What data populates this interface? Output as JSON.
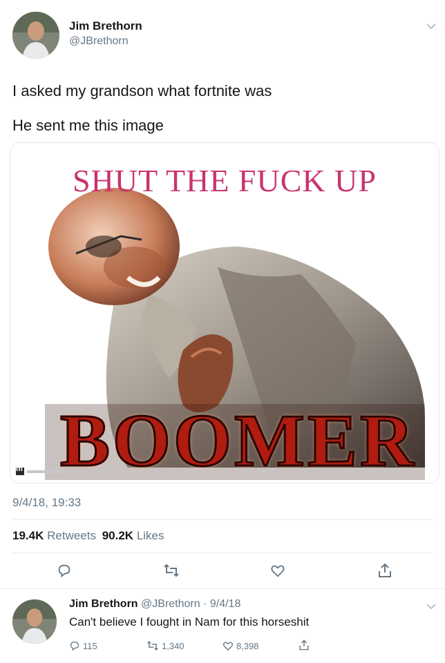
{
  "tweet": {
    "author_name": "Jim Brethorn",
    "author_handle": "@JBrethorn",
    "text_lines": [
      "I asked my grandson what fortnite was",
      "He sent me this image"
    ],
    "media": {
      "top_caption": "SHUT THE FUCK UP",
      "bottom_caption": "BOOMER",
      "watermark": "m"
    },
    "timestamp": "9/4/18, 19:33",
    "retweets_count": "19.4K",
    "retweets_label": "Retweets",
    "likes_count": "90.2K",
    "likes_label": "Likes"
  },
  "reply": {
    "author_name": "Jim Brethorn",
    "author_handle": "@JBrethorn",
    "date": "· 9/4/18",
    "text": "Can't believe I fought in Nam for this horseshit",
    "reply_count": "115",
    "retweet_count": "1,340",
    "like_count": "8,398"
  },
  "icons": [
    "chevron-down-icon",
    "reply-icon",
    "retweet-icon",
    "like-icon",
    "share-icon"
  ],
  "colors": {
    "text": "#14171a",
    "secondary": "#657786",
    "caption_pink": "#c8336e",
    "boomer_red": "#b01c10"
  }
}
